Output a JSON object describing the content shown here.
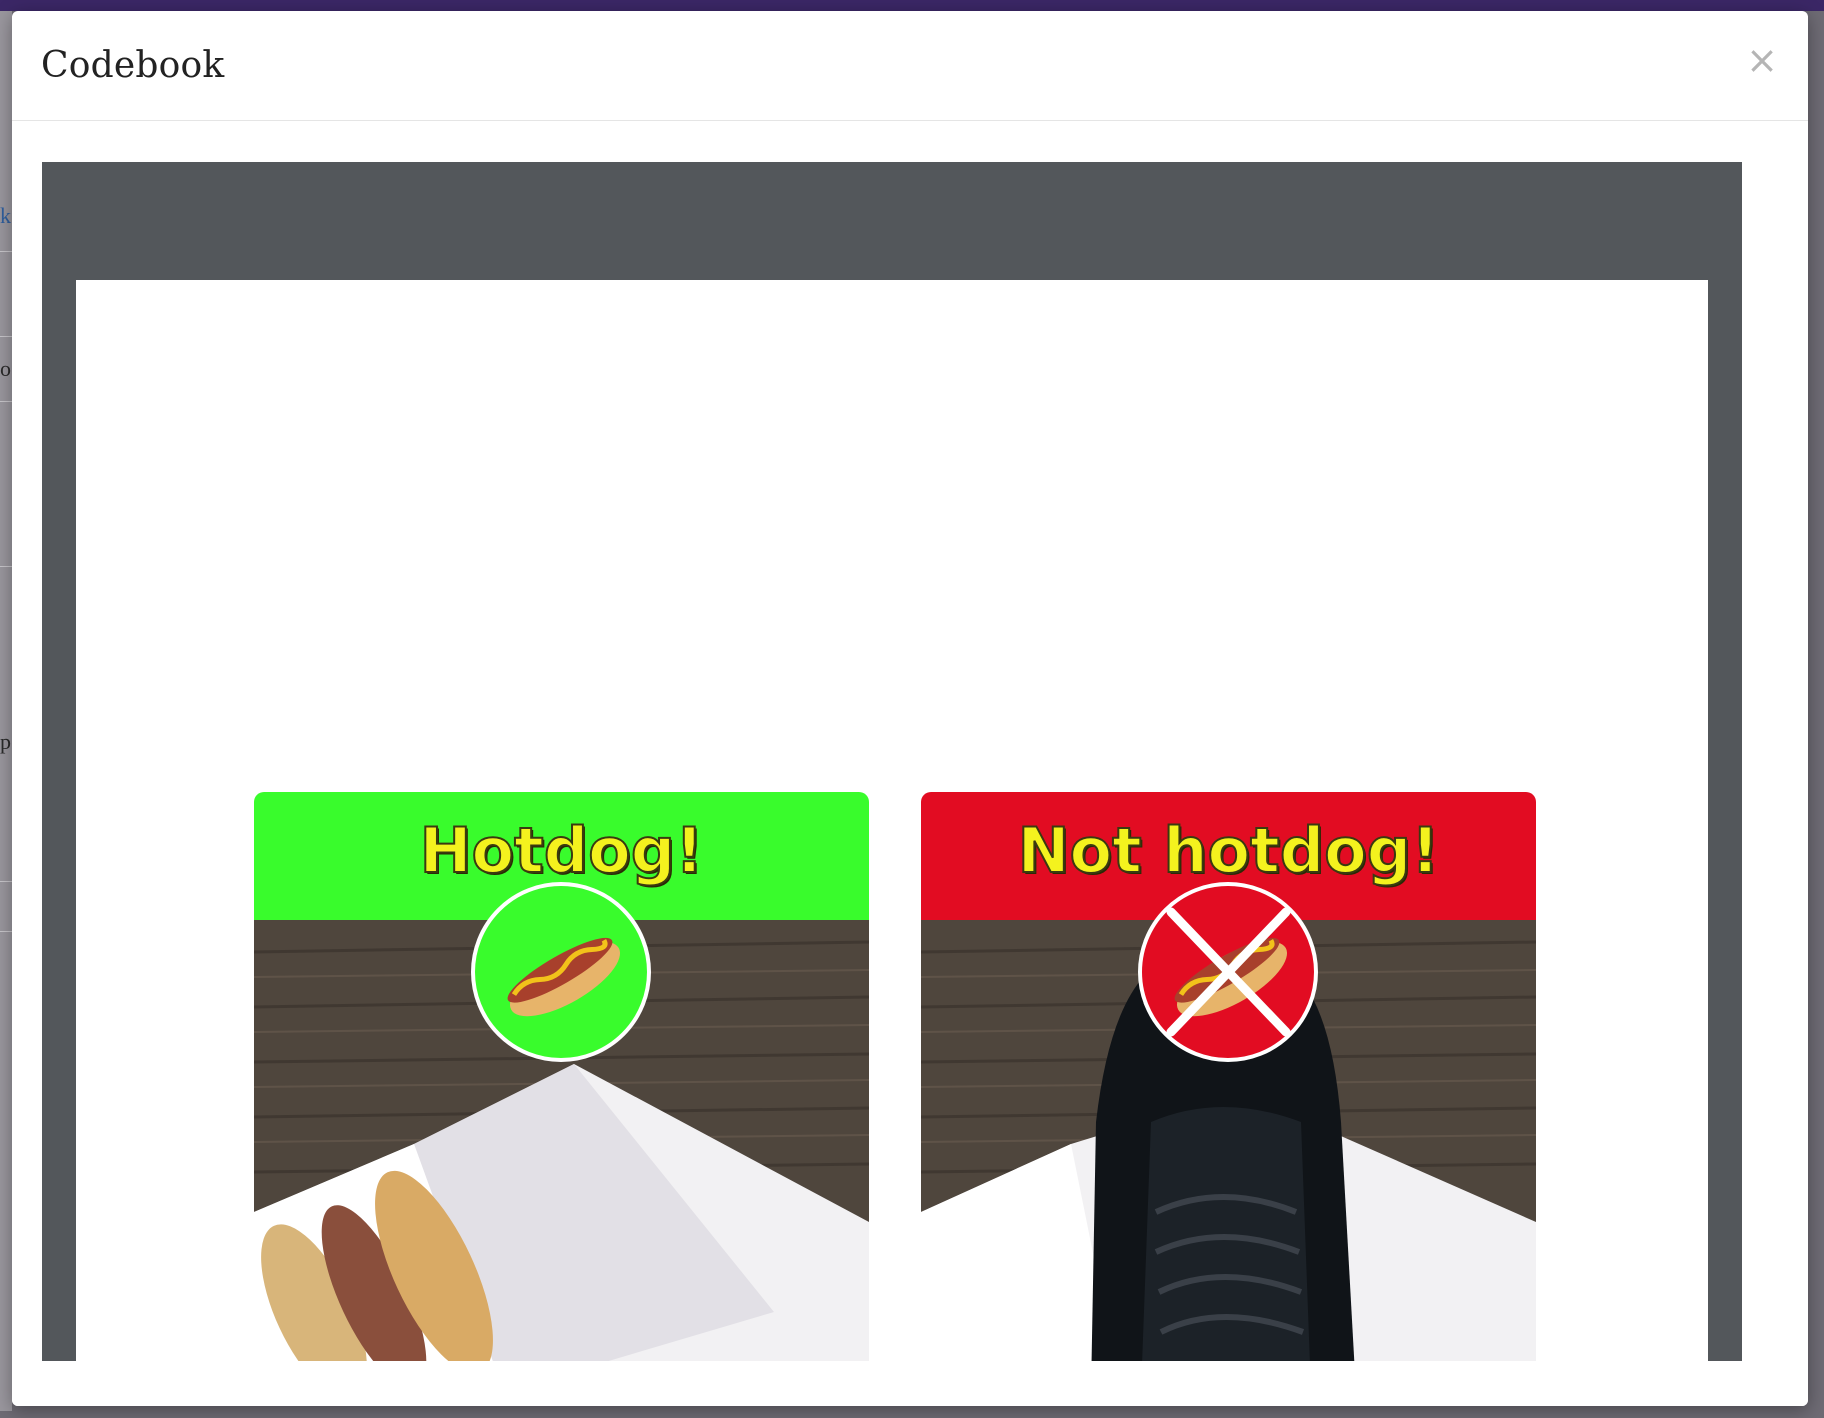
{
  "modal": {
    "title": "Codebook",
    "close_symbol": "×"
  },
  "cards": [
    {
      "label": "Hotdog!",
      "banner_color": "#39fc2c",
      "icon": "hotdog-icon"
    },
    {
      "label": "Not hotdog!",
      "banner_color": "#e20c22",
      "icon": "hotdog-crossed-icon"
    }
  ],
  "background_fragments": [
    "k",
    "o",
    "p"
  ]
}
